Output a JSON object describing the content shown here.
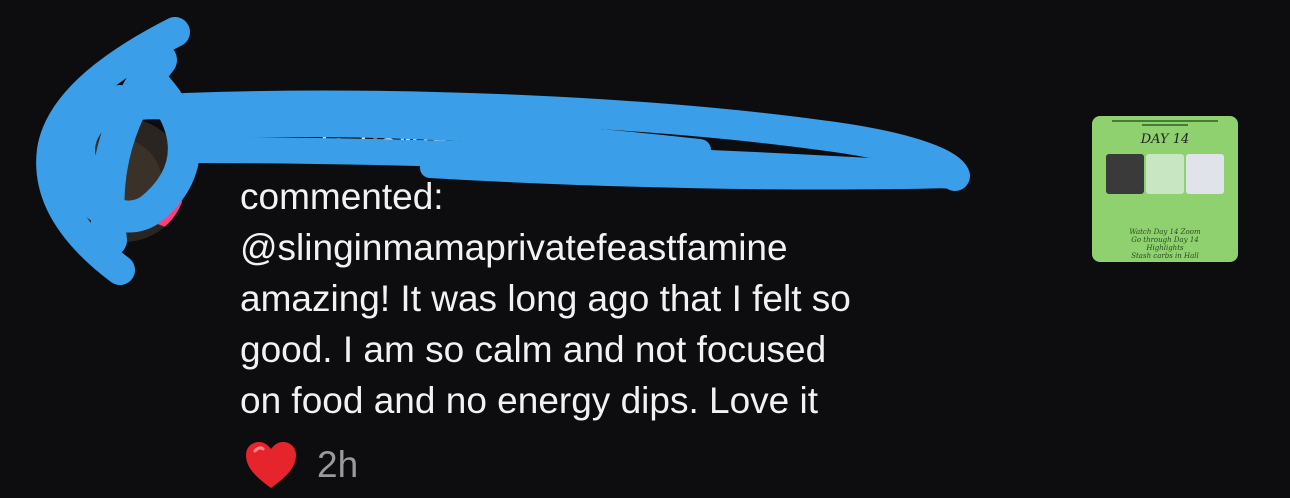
{
  "notification": {
    "action": "commented:",
    "mention": "@slinginmamaprivatefeastfamine",
    "comment_lines": [
      "amazing! It was long ago that I felt so",
      "good. I am so calm and not focused",
      "on food and no energy dips. Love it"
    ],
    "reaction_icon": "red-heart-icon",
    "timestamp": "2h"
  },
  "thumbnail": {
    "title": "DAY 14",
    "caption_lines": [
      "Watch Day 14 Zoom",
      "Go through Day 14 Highlights",
      "Stash carbs in Hall"
    ]
  },
  "colors": {
    "background": "#0d0d0f",
    "text": "#f2f2f2",
    "timestamp": "#9a9a9a",
    "redaction": "#3a9ee8",
    "thumbnail_bg": "#8fd16e",
    "heart": "#e5252b"
  }
}
